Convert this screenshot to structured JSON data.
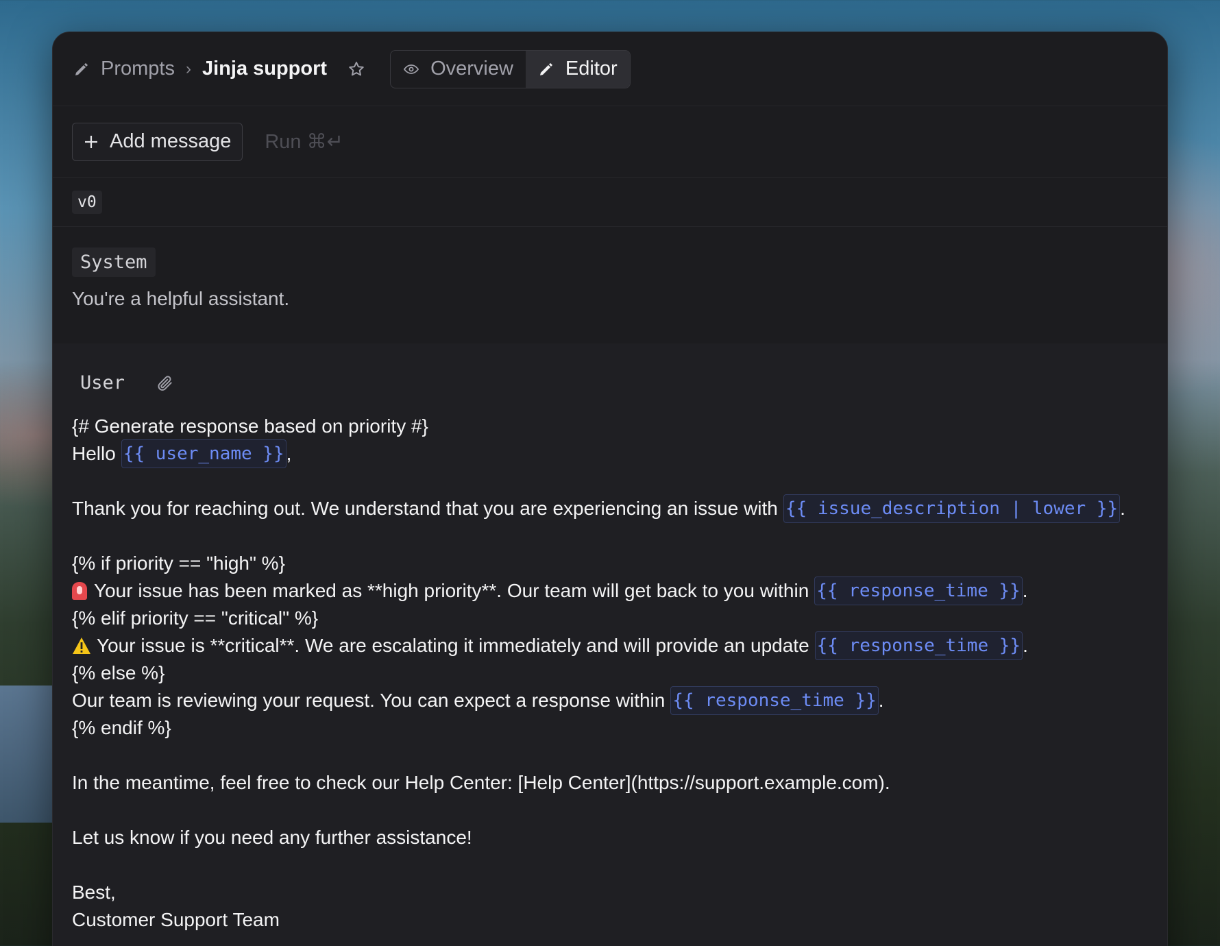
{
  "header": {
    "breadcrumb_root": "Prompts",
    "breadcrumb_separator": "›",
    "breadcrumb_current": "Jinja support",
    "tabs": [
      {
        "label": "Overview",
        "icon": "eye-icon",
        "active": false
      },
      {
        "label": "Editor",
        "icon": "pencil-icon",
        "active": true
      }
    ]
  },
  "toolbar": {
    "add_message_label": "Add message",
    "run_label": "Run ⌘↵"
  },
  "version": "v0",
  "system": {
    "role": "System",
    "text": "You're a helpful assistant."
  },
  "user": {
    "role": "User",
    "lines": [
      "{# Generate response based on priority #}",
      "Hello",
      ",",
      "Thank you for reaching out. We understand that you are experiencing an issue with",
      ".",
      "{% if priority == \"high\" %}",
      "Your issue has been marked as **high priority**. Our team will get back to you within",
      "{% elif priority == \"critical\" %}",
      "Your issue is **critical**. We are escalating it immediately and will provide an update",
      "{% else %}",
      "Our team is reviewing your request. You can expect a response within",
      "{% endif %}",
      "In the meantime, feel free to check our Help Center: [Help Center](https://support.example.com).",
      "Let us know if you need any further assistance!",
      "Best,",
      "Customer Support Team"
    ],
    "vars": {
      "user_name": "{{ user_name }}",
      "issue_description": "{{ issue_description | lower }}",
      "response_time": "{{ response_time }}"
    }
  },
  "colors": {
    "window_bg": "#1c1c1f",
    "user_bg": "#1f1f23",
    "variable": "#6d8cf5"
  }
}
